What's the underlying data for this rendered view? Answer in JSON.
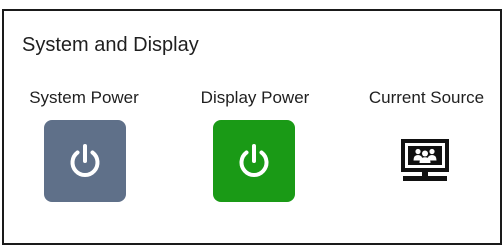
{
  "panel": {
    "title": "System and Display"
  },
  "controls": [
    {
      "label": "System Power",
      "state": "off",
      "icon": "power-icon",
      "color": "#5f7089"
    },
    {
      "label": "Display Power",
      "state": "on",
      "icon": "power-icon",
      "color": "#1a9a16"
    },
    {
      "label": "Current Source",
      "icon": "presentation-screen-icon",
      "color": "#111111"
    }
  ]
}
